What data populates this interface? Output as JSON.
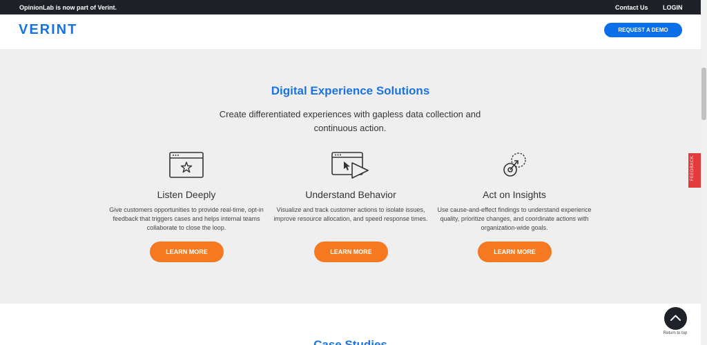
{
  "topbar": {
    "announcement": "OpinionLab is now part of Verint.",
    "contact_label": "Contact Us",
    "login_label": "LOGIN"
  },
  "header": {
    "logo_text": "VERINT",
    "cta_label": "REQUEST A DEMO"
  },
  "solutions": {
    "title": "Digital Experience Solutions",
    "subtitle": "Create differentiated experiences with gapless data collection and continuous action.",
    "cards": [
      {
        "icon": "browser-star-icon",
        "title": "Listen Deeply",
        "text": "Give customers opportunities to provide real-time, opt-in feedback that triggers cases and helps internal teams collaborate to close the loop.",
        "button": "LEARN MORE"
      },
      {
        "icon": "browser-cursor-play-icon",
        "title": "Understand Behavior",
        "text": "Visualize and track customer actions to isolate issues, improve resource allocation, and speed response times.",
        "button": "LEARN MORE"
      },
      {
        "icon": "target-arrow-icon",
        "title": "Act on Insights",
        "text": "Use cause-and-effect findings to understand experience quality, prioritize changes, and coordinate actions with organization-wide goals.",
        "button": "LEARN MORE"
      }
    ]
  },
  "feedback_tab": {
    "label": "FEEDBACK"
  },
  "return_to_top": {
    "label": "Return to top"
  },
  "next_section": {
    "heading": "Case Studies"
  },
  "colors": {
    "brand_blue": "#1473e6",
    "cta_orange": "#f47920",
    "topbar_dark": "#1f2129",
    "section_bg": "#efefef",
    "feedback_red": "#e23b3b"
  }
}
